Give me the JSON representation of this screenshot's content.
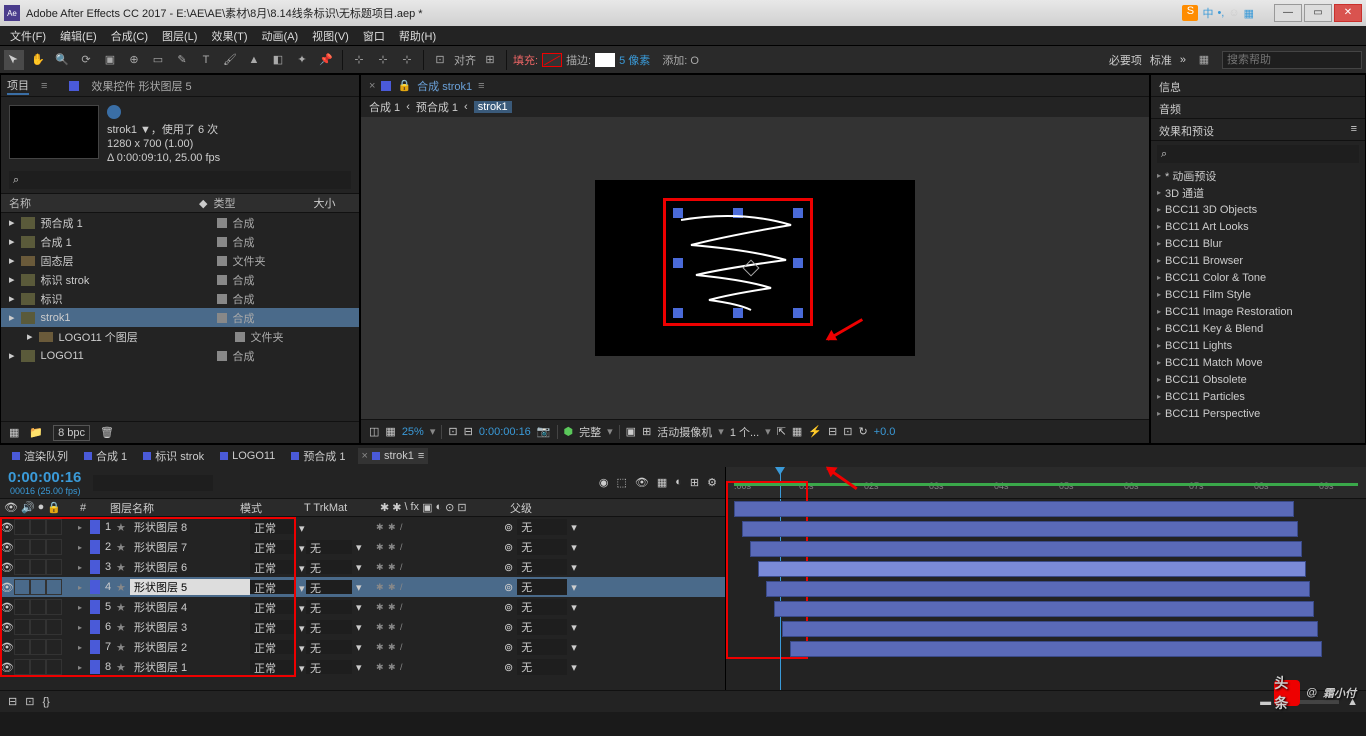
{
  "title": "Adobe After Effects CC 2017 - E:\\AE\\AE\\素材\\8月\\8.14线条标识\\无标题项目.aep *",
  "ime": {
    "cn": "中",
    "dot": "•,",
    "smile": "😊"
  },
  "menu": [
    "文件(F)",
    "编辑(E)",
    "合成(C)",
    "图层(L)",
    "效果(T)",
    "动画(A)",
    "视图(V)",
    "窗口",
    "帮助(H)"
  ],
  "toolbar_text": {
    "snap": "对齐",
    "fill": "填充:",
    "stroke": "描边:",
    "px": "5 像素",
    "add": "添加: O"
  },
  "workspace": {
    "essentials": "必要项",
    "standard": "标准",
    "chev": "»"
  },
  "search_placeholder": "搜索帮助",
  "project": {
    "tab": "项目",
    "effects_tab": "效果控件 形状图层 5",
    "meta_name": "strok1 ▼，使用了 6 次",
    "meta_res": "1280 x 700 (1.00)",
    "meta_dur": "Δ 0:00:09:10, 25.00 fps",
    "cols": {
      "name": "名称",
      "type": "类型",
      "size": "大小"
    },
    "items": [
      {
        "name": "预合成 1",
        "type": "合成",
        "icon": "comp"
      },
      {
        "name": "合成 1",
        "type": "合成",
        "icon": "comp"
      },
      {
        "name": "固态层",
        "type": "文件夹",
        "icon": "folder"
      },
      {
        "name": "标识 strok",
        "type": "合成",
        "icon": "comp"
      },
      {
        "name": "标识",
        "type": "合成",
        "icon": "comp"
      },
      {
        "name": "strok1",
        "type": "合成",
        "icon": "comp",
        "sel": true
      },
      {
        "name": "LOGO11 个图层",
        "type": "文件夹",
        "icon": "folder",
        "indent": true
      },
      {
        "name": "LOGO11",
        "type": "合成",
        "icon": "comp"
      }
    ],
    "footer_bpc": "8 bpc"
  },
  "composition": {
    "name": "合成 strok1",
    "crumbs": [
      "合成 1",
      "预合成 1",
      "strok1"
    ]
  },
  "viewer_controls": {
    "zoom": "25%",
    "time": "0:00:00:16",
    "res": "完整",
    "camera": "活动摄像机",
    "views": "1 个...",
    "exp": "+0.0"
  },
  "right_panel": {
    "info": "信息",
    "audio": "音频",
    "effects": "效果和预设",
    "presets": [
      "* 动画预设",
      "3D 通道",
      "BCC11 3D Objects",
      "BCC11 Art Looks",
      "BCC11 Blur",
      "BCC11 Browser",
      "BCC11 Color & Tone",
      "BCC11 Film Style",
      "BCC11 Image Restoration",
      "BCC11 Key & Blend",
      "BCC11 Lights",
      "BCC11 Match Move",
      "BCC11 Obsolete",
      "BCC11 Particles",
      "BCC11 Perspective"
    ]
  },
  "timeline": {
    "tabs": [
      {
        "name": "渲染队列"
      },
      {
        "name": "合成 1"
      },
      {
        "name": "标识 strok"
      },
      {
        "name": "LOGO11"
      },
      {
        "name": "预合成 1"
      },
      {
        "name": "strok1",
        "active": true
      }
    ],
    "timecode": "0:00:00:16",
    "timecode_sub": "00016 (25.00 fps)",
    "headers": {
      "layer": "图层名称",
      "mode": "模式",
      "trk": "T  TrkMat",
      "parent": "父级"
    },
    "mode_normal": "正常",
    "trk_none": "无",
    "parent_none": "无",
    "layers": [
      {
        "n": 1,
        "name": "形状图层 8"
      },
      {
        "n": 2,
        "name": "形状图层 7"
      },
      {
        "n": 3,
        "name": "形状图层 6"
      },
      {
        "n": 4,
        "name": "形状图层 5",
        "sel": true
      },
      {
        "n": 5,
        "name": "形状图层 4"
      },
      {
        "n": 6,
        "name": "形状图层 3"
      },
      {
        "n": 7,
        "name": "形状图层 2"
      },
      {
        "n": 8,
        "name": "形状图层 1"
      }
    ],
    "ticks": [
      ":00s",
      "01s",
      "02s",
      "03s",
      "04s",
      "05s",
      "06s",
      "07s",
      "08s",
      "09s"
    ]
  },
  "watermark": {
    "at": "@",
    "name": "霜小付"
  }
}
